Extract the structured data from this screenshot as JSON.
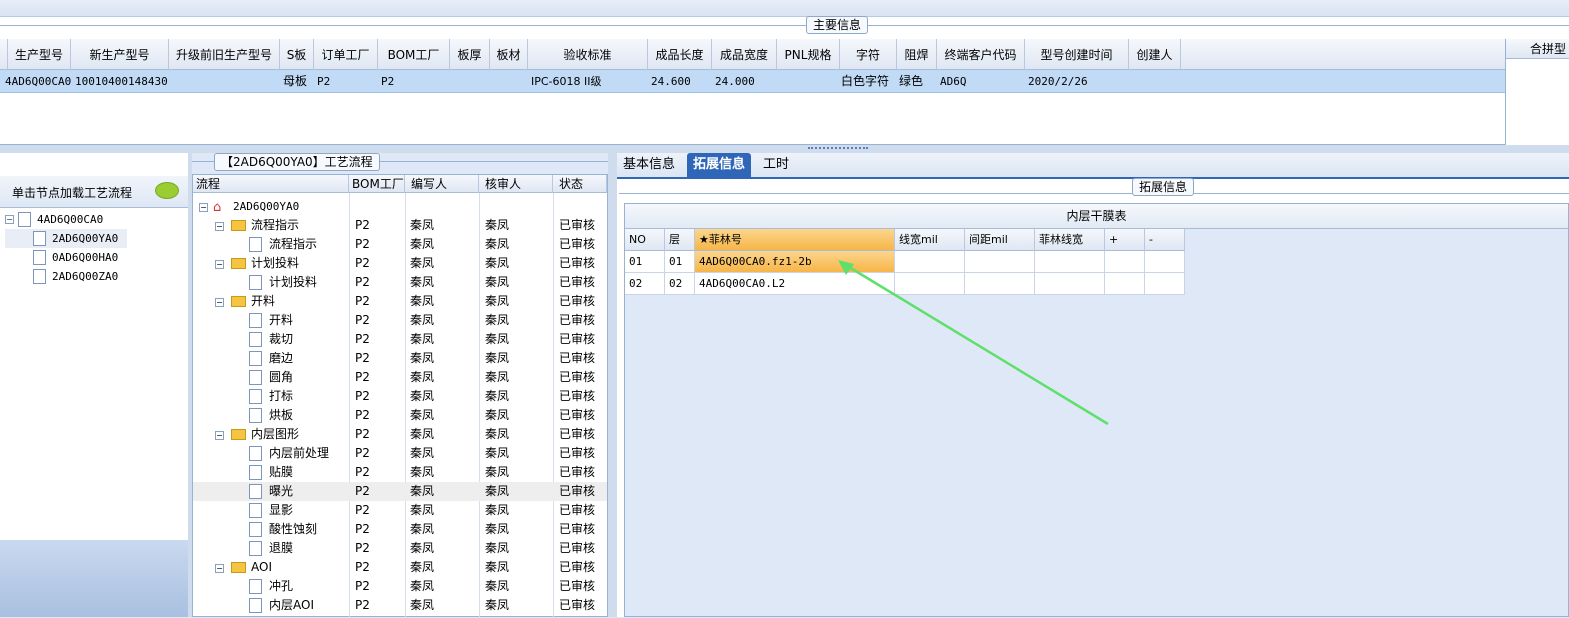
{
  "main_info": {
    "caption": "主要信息",
    "side_caption": "合拼型",
    "columns": [
      "生产型号",
      "新生产型号",
      "升级前旧生产型号",
      "S板",
      "订单工厂",
      "BOM工厂",
      "板厚",
      "板材",
      "验收标准",
      "成品长度",
      "成品宽度",
      "PNL规格",
      "字符",
      "阻焊",
      "终端客户代码",
      "型号创建时间",
      "创建人"
    ],
    "row": {
      "prod_model": "4AD6Q00CA0",
      "new_model": "10010400148430",
      "old_model": "",
      "s_board": "母板",
      "order_factory": "P2",
      "bom_factory": "P2",
      "thickness": "",
      "material": "",
      "standard": "IPC-6018 II级",
      "length": "24.600",
      "width": "24.000",
      "pnl": "",
      "char": "白色字符",
      "mask": "绿色",
      "customer": "AD6Q",
      "created": "2020/2/26",
      "creator": ""
    }
  },
  "left": {
    "load_label": "单击节点加载工艺流程",
    "tree": {
      "root": "4AD6Q00CA0",
      "children": [
        "2AD6Q00YA0",
        "0AD6Q00HA0",
        "2AD6Q00ZA0"
      ]
    }
  },
  "flow": {
    "caption": "【2AD6Q00YA0】工艺流程",
    "headers": [
      "流程",
      "BOM工厂",
      "编写人",
      "核审人",
      "状态"
    ],
    "root": "2AD6Q00YA0",
    "rows": [
      {
        "name": "流程指示",
        "level": 1,
        "folder": true,
        "factory": "P2",
        "writer": "秦凤",
        "reviewer": "秦凤",
        "status": "已审核"
      },
      {
        "name": "流程指示",
        "level": 2,
        "folder": false,
        "factory": "P2",
        "writer": "秦凤",
        "reviewer": "秦凤",
        "status": "已审核"
      },
      {
        "name": "计划投料",
        "level": 1,
        "folder": true,
        "factory": "P2",
        "writer": "秦凤",
        "reviewer": "秦凤",
        "status": "已审核"
      },
      {
        "name": "计划投料",
        "level": 2,
        "folder": false,
        "factory": "P2",
        "writer": "秦凤",
        "reviewer": "秦凤",
        "status": "已审核"
      },
      {
        "name": "开料",
        "level": 1,
        "folder": true,
        "factory": "P2",
        "writer": "秦凤",
        "reviewer": "秦凤",
        "status": "已审核"
      },
      {
        "name": "开料",
        "level": 2,
        "folder": false,
        "factory": "P2",
        "writer": "秦凤",
        "reviewer": "秦凤",
        "status": "已审核"
      },
      {
        "name": "裁切",
        "level": 2,
        "folder": false,
        "factory": "P2",
        "writer": "秦凤",
        "reviewer": "秦凤",
        "status": "已审核"
      },
      {
        "name": "磨边",
        "level": 2,
        "folder": false,
        "factory": "P2",
        "writer": "秦凤",
        "reviewer": "秦凤",
        "status": "已审核"
      },
      {
        "name": "圆角",
        "level": 2,
        "folder": false,
        "factory": "P2",
        "writer": "秦凤",
        "reviewer": "秦凤",
        "status": "已审核"
      },
      {
        "name": "打标",
        "level": 2,
        "folder": false,
        "factory": "P2",
        "writer": "秦凤",
        "reviewer": "秦凤",
        "status": "已审核"
      },
      {
        "name": "烘板",
        "level": 2,
        "folder": false,
        "factory": "P2",
        "writer": "秦凤",
        "reviewer": "秦凤",
        "status": "已审核"
      },
      {
        "name": "内层图形",
        "level": 1,
        "folder": true,
        "factory": "P2",
        "writer": "秦凤",
        "reviewer": "秦凤",
        "status": "已审核"
      },
      {
        "name": "内层前处理",
        "level": 2,
        "folder": false,
        "factory": "P2",
        "writer": "秦凤",
        "reviewer": "秦凤",
        "status": "已审核"
      },
      {
        "name": "贴膜",
        "level": 2,
        "folder": false,
        "factory": "P2",
        "writer": "秦凤",
        "reviewer": "秦凤",
        "status": "已审核"
      },
      {
        "name": "曝光",
        "level": 2,
        "folder": false,
        "factory": "P2",
        "writer": "秦凤",
        "reviewer": "秦凤",
        "status": "已审核",
        "selected": true
      },
      {
        "name": "显影",
        "level": 2,
        "folder": false,
        "factory": "P2",
        "writer": "秦凤",
        "reviewer": "秦凤",
        "status": "已审核"
      },
      {
        "name": "酸性蚀刻",
        "level": 2,
        "folder": false,
        "factory": "P2",
        "writer": "秦凤",
        "reviewer": "秦凤",
        "status": "已审核"
      },
      {
        "name": "退膜",
        "level": 2,
        "folder": false,
        "factory": "P2",
        "writer": "秦凤",
        "reviewer": "秦凤",
        "status": "已审核"
      },
      {
        "name": "AOI",
        "level": 1,
        "folder": true,
        "factory": "P2",
        "writer": "秦凤",
        "reviewer": "秦凤",
        "status": "已审核"
      },
      {
        "name": "冲孔",
        "level": 2,
        "folder": false,
        "factory": "P2",
        "writer": "秦凤",
        "reviewer": "秦凤",
        "status": "已审核"
      },
      {
        "name": "内层AOI",
        "level": 2,
        "folder": false,
        "factory": "P2",
        "writer": "秦凤",
        "reviewer": "秦凤",
        "status": "已审核"
      }
    ]
  },
  "tabs": {
    "basic": "基本信息",
    "extended": "拓展信息",
    "hours": "工时"
  },
  "extended": {
    "caption": "拓展信息",
    "table_title": "内层干膜表",
    "headers": [
      "NO",
      "层",
      "★菲林号",
      "线宽mil",
      "间距mil",
      "菲林线宽",
      "+",
      "-"
    ],
    "rows": [
      {
        "no": "01",
        "layer": "01",
        "film": "4AD6Q00CA0.fz1-2b"
      },
      {
        "no": "02",
        "layer": "02",
        "film": "4AD6Q00CA0.L2"
      }
    ]
  },
  "colors": {
    "selection": "#c1daf5",
    "highlight": "#f7b548",
    "tab_active": "#2f66b8",
    "arrow": "#5ee06a"
  }
}
